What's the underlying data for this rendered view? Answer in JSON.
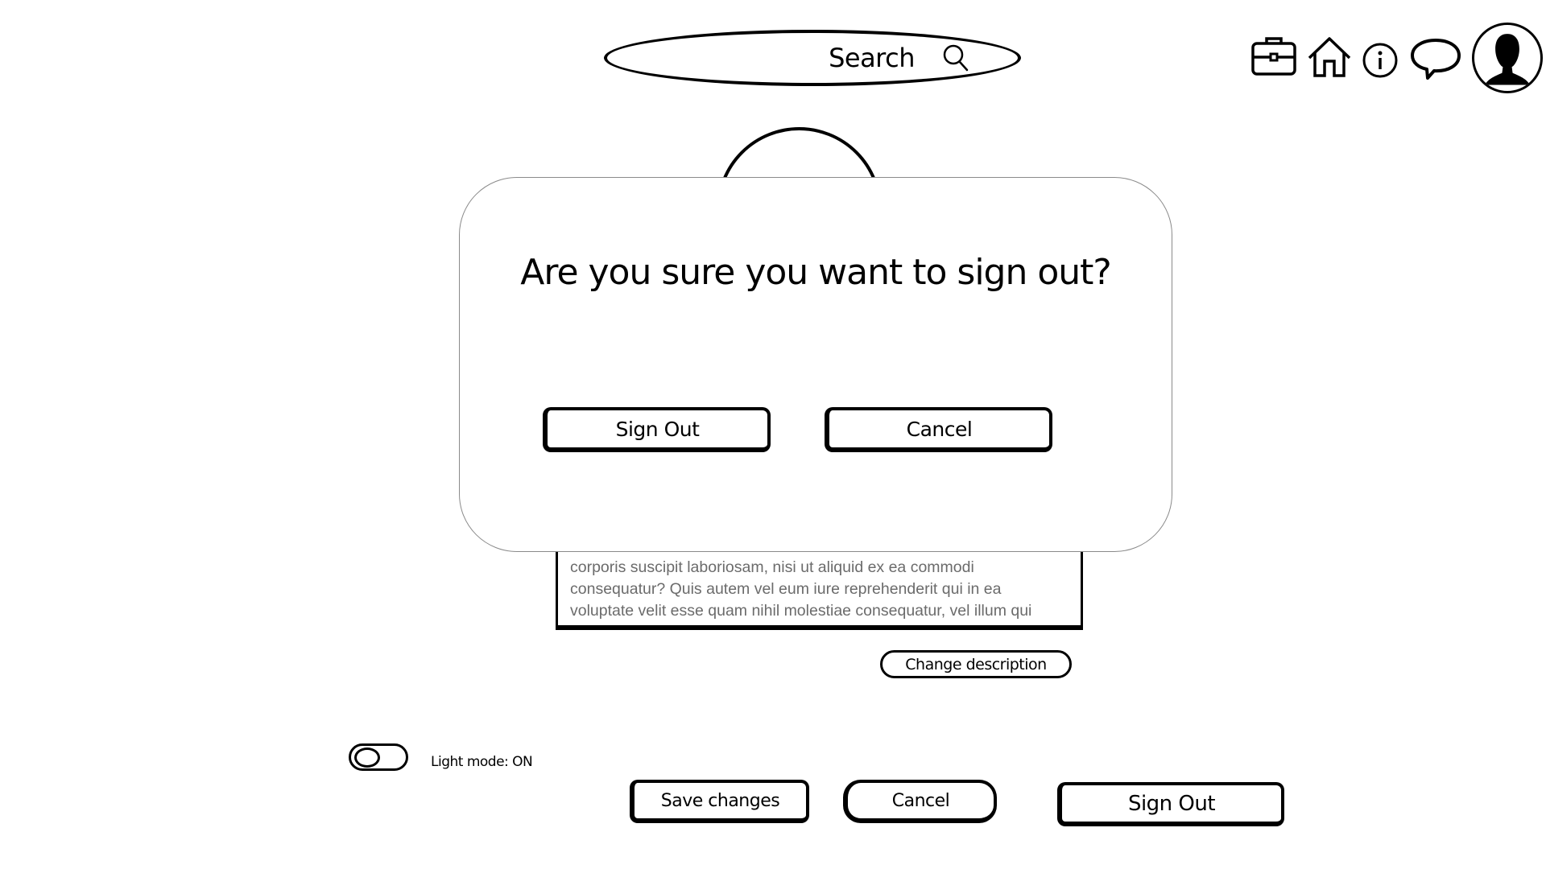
{
  "header": {
    "search": {
      "placeholder": "Search",
      "icon": "search-icon"
    },
    "icons": [
      {
        "name": "briefcase-icon"
      },
      {
        "name": "home-icon"
      },
      {
        "name": "info-icon"
      },
      {
        "name": "chat-icon"
      },
      {
        "name": "avatar-icon"
      }
    ]
  },
  "profile": {
    "description_lines": [
      "corporis suscipit laboriosam, nisi ut aliquid ex ea commodi",
      "consequatur? Quis autem vel eum iure reprehenderit qui in ea",
      "voluptate velit esse quam nihil molestiae consequatur, vel illum qui"
    ],
    "change_description_label": "Change description"
  },
  "settings": {
    "light_mode_label": "Light mode: ON",
    "light_mode_on": true
  },
  "actions": {
    "save_label": "Save changes",
    "cancel_label": "Cancel",
    "signout_label": "Sign Out"
  },
  "modal": {
    "title": "Are you sure you want to sign out?",
    "confirm_label": "Sign Out",
    "cancel_label": "Cancel"
  }
}
